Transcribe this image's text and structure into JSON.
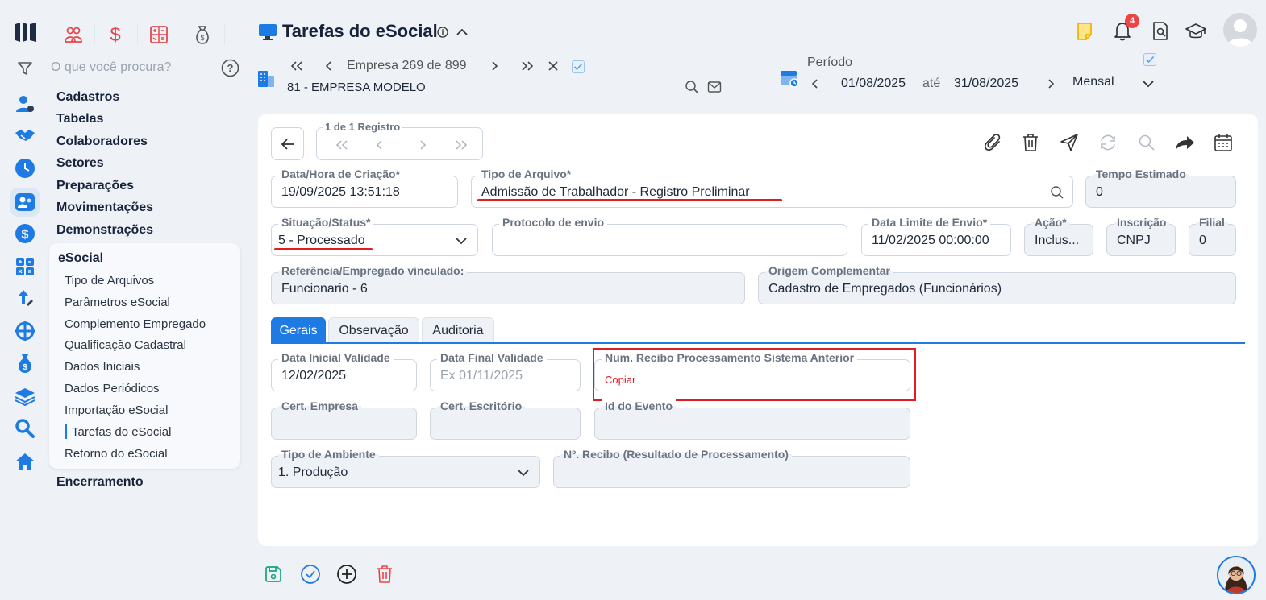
{
  "app": {
    "search_placeholder": "O que você procura?"
  },
  "sidebar": {
    "main_items": [
      {
        "label": "Cadastros"
      },
      {
        "label": "Tabelas"
      },
      {
        "label": "Colaboradores"
      },
      {
        "label": "Setores"
      },
      {
        "label": "Preparações"
      },
      {
        "label": "Movimentações"
      },
      {
        "label": "Demonstrações"
      }
    ],
    "submenu_title": "eSocial",
    "submenu_items": [
      {
        "label": "Tipo de Arquivos"
      },
      {
        "label": "Parâmetros eSocial"
      },
      {
        "label": "Complemento Empregado"
      },
      {
        "label": "Qualificação Cadastral"
      },
      {
        "label": "Dados Iniciais"
      },
      {
        "label": "Dados Periódicos"
      },
      {
        "label": "Importação eSocial"
      },
      {
        "label": "Tarefas do eSocial"
      },
      {
        "label": "Retorno do eSocial"
      }
    ],
    "last_item": "Encerramento"
  },
  "header": {
    "title": "Tarefas do eSocial",
    "notification_count": "4",
    "empresa_label": "Empresa 269 de 899",
    "empresa_name": "81 - EMPRESA MODELO",
    "periodo_label": "Período",
    "period_start": "01/08/2025",
    "period_sep": "até",
    "period_end": "31/08/2025",
    "period_mode": "Mensal"
  },
  "record_nav": {
    "label": "1 de 1 Registro"
  },
  "form": {
    "data_hora": {
      "label": "Data/Hora de Criação*",
      "value": "19/09/2025 13:51:18"
    },
    "tipo_arquivo": {
      "label": "Tipo de Arquivo*",
      "value": "Admissão de Trabalhador - Registro Preliminar"
    },
    "tempo_estimado": {
      "label": "Tempo Estimado",
      "value": "0"
    },
    "situacao": {
      "label": "Situação/Status*",
      "value": "5 - Processado"
    },
    "protocolo": {
      "label": "Protocolo de envio",
      "value": ""
    },
    "data_limite": {
      "label": "Data Limite de Envio*",
      "value": "11/02/2025 00:00:00"
    },
    "acao": {
      "label": "Ação*",
      "value": "Inclus..."
    },
    "inscricao": {
      "label": "Inscrição",
      "value": "CNPJ"
    },
    "filial": {
      "label": "Filial",
      "value": "0"
    },
    "referencia": {
      "label": "Referência/Empregado vinculado:",
      "value": "Funcionario - 6"
    },
    "origem": {
      "label": "Origem Complementar",
      "value": "Cadastro de Empregados (Funcionários)"
    }
  },
  "tabs": [
    {
      "label": "Gerais"
    },
    {
      "label": "Observação"
    },
    {
      "label": "Auditoria"
    }
  ],
  "gerais": {
    "data_inicial": {
      "label": "Data Inicial Validade",
      "value": "12/02/2025"
    },
    "data_final": {
      "label": "Data Final Validade",
      "placeholder": "Ex 01/11/2025"
    },
    "num_recibo": {
      "label": "Num. Recibo Processamento Sistema Anterior",
      "action": "Copiar"
    },
    "cert_empresa": {
      "label": "Cert. Empresa",
      "value": ""
    },
    "cert_escritorio": {
      "label": "Cert. Escritório",
      "value": ""
    },
    "id_evento": {
      "label": "Id do Evento",
      "value": ""
    },
    "tipo_ambiente": {
      "label": "Tipo de Ambiente",
      "value": "1. Produção"
    },
    "n_recibo": {
      "label": "Nº. Recibo (Resultado de Processamento)",
      "value": ""
    }
  },
  "colors": {
    "accent": "#1e7be3",
    "highlight_red": "#e11d23",
    "module_red": "#e5484d"
  }
}
